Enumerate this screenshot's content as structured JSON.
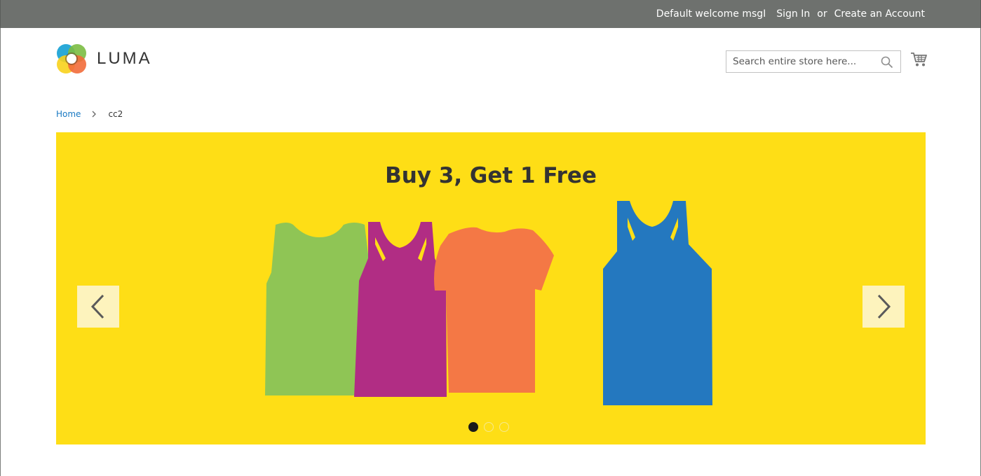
{
  "header": {
    "welcome": "Default welcome msgI",
    "sign_in": "Sign In",
    "or": "or",
    "create_account": "Create an Account"
  },
  "logo": {
    "wordmark": "LUMA"
  },
  "search": {
    "placeholder": "Search entire store here..."
  },
  "breadcrumbs": {
    "home": "Home",
    "current": "cc2"
  },
  "banner": {
    "headline": "Buy 3, Get 1 Free",
    "background": "#fede16",
    "slides": 3,
    "active_slide": 1
  },
  "icons": {
    "search": "magnifier-icon",
    "cart": "shopping-cart-icon",
    "prev": "chevron-left-icon",
    "next": "chevron-right-icon",
    "breadcrumb_separator": "chevron-right-icon"
  },
  "colors": {
    "topbar": "#6e716e",
    "link": "#1979c3",
    "text": "#333333",
    "shirt_green": "#8fc555",
    "shirt_magenta": "#b12d84",
    "shirt_orange": "#f47845",
    "shirt_blue": "#2478bf"
  }
}
